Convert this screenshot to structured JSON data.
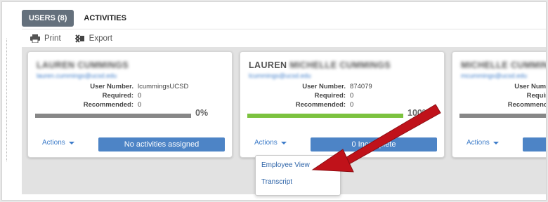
{
  "tabs": [
    {
      "label": "USERS (8)",
      "active": true
    },
    {
      "label": "ACTIVITIES",
      "active": false
    }
  ],
  "toolbar": {
    "print_label": "Print",
    "print_icon": "printer-icon",
    "export_label": "Export",
    "export_icon": "excel-export-icon"
  },
  "labels": {
    "user_number": "User Number.",
    "required": "Required:",
    "recommended": "Recommended:",
    "actions": "Actions"
  },
  "cards": [
    {
      "name": "LAUREN CUMMINGS",
      "name_plain": "",
      "name_blurred": "LAUREN CUMMINGS",
      "email": "lauren.cummings@ucsd.edu",
      "user_number": "lcummingsUCSD",
      "required": "0",
      "recommended": "0",
      "progress_percent": 0,
      "progress_label": "0%",
      "button_label": "No activities assigned"
    },
    {
      "name": "LAUREN MICHELLE CUMMINGS",
      "name_plain": "LAUREN",
      "name_blurred": "MICHELLE CUMMINGS",
      "email": "lcummings@ucsd.edu",
      "user_number": "874079",
      "required": "0",
      "recommended": "0",
      "progress_percent": 100,
      "progress_label": "100%",
      "button_label": "0 Incomplete"
    },
    {
      "name": "MICHELLE CUMMINGS",
      "name_plain": "",
      "name_blurred": "MICHELLE CUMMINGS",
      "email": "mcummings@ucsd.edu",
      "user_number": "",
      "required": "",
      "recommended": "",
      "progress_percent": 0,
      "progress_label": "",
      "button_label": ""
    }
  ],
  "actions_menu": {
    "items": [
      "Employee View",
      "Transcript"
    ]
  },
  "colors": {
    "tab_active": "#64707c",
    "accent_blue": "#4d84c6",
    "progress_green": "#7cc23f",
    "arrow_red": "#c0121a"
  }
}
